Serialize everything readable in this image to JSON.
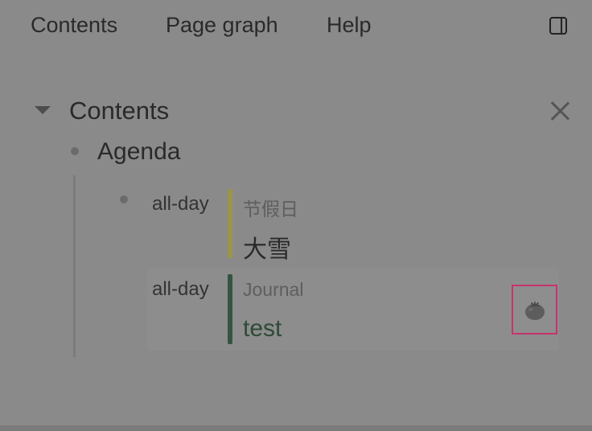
{
  "tabs": {
    "contents": "Contents",
    "page_graph": "Page graph",
    "help": "Help"
  },
  "icons": {
    "toggle": "sidebar-toggle-icon",
    "collapse": "caret-down-icon",
    "close": "close-icon",
    "pomodoro": "tomato-icon"
  },
  "contents": {
    "title": "Contents",
    "agenda": {
      "label": "Agenda",
      "events": [
        {
          "time": "all-day",
          "calendar": "节假日",
          "title": "大雪",
          "color": "#99954a"
        },
        {
          "time": "all-day",
          "calendar": "Journal",
          "title": "test",
          "color": "#345442"
        }
      ]
    }
  },
  "colors": {
    "highlight_border": "#c7336c",
    "background": "#8a8a8a"
  }
}
